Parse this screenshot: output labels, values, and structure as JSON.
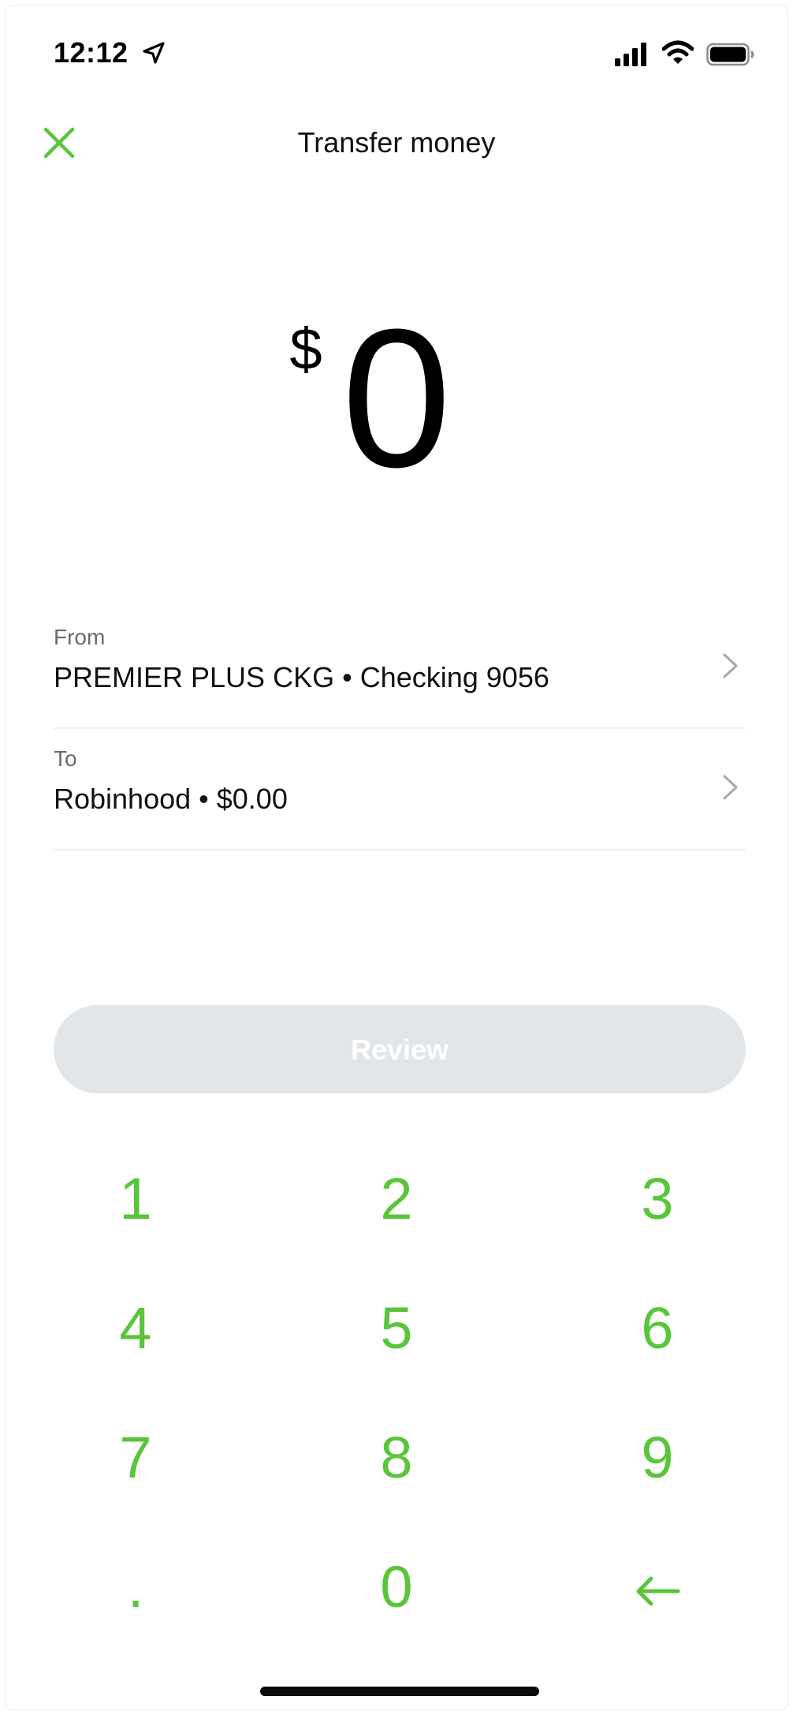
{
  "status_bar": {
    "time": "12:12"
  },
  "header": {
    "title": "Transfer money"
  },
  "amount": {
    "currency_symbol": "$",
    "value": "0"
  },
  "transfer": {
    "from": {
      "label": "From",
      "value": "PREMIER PLUS CKG • Checking 9056"
    },
    "to": {
      "label": "To",
      "value": "Robinhood • $0.00"
    }
  },
  "review_button": {
    "label": "Review"
  },
  "keypad": {
    "keys": [
      "1",
      "2",
      "3",
      "4",
      "5",
      "6",
      "7",
      "8",
      "9",
      ".",
      "0"
    ]
  },
  "colors": {
    "accent": "#5ac53b",
    "button_disabled": "#e2e6e9",
    "divider": "#f0f0f0"
  },
  "icons": {
    "close": "close-icon",
    "backspace": "backspace-arrow-icon",
    "chevron": "chevron-right-icon"
  }
}
